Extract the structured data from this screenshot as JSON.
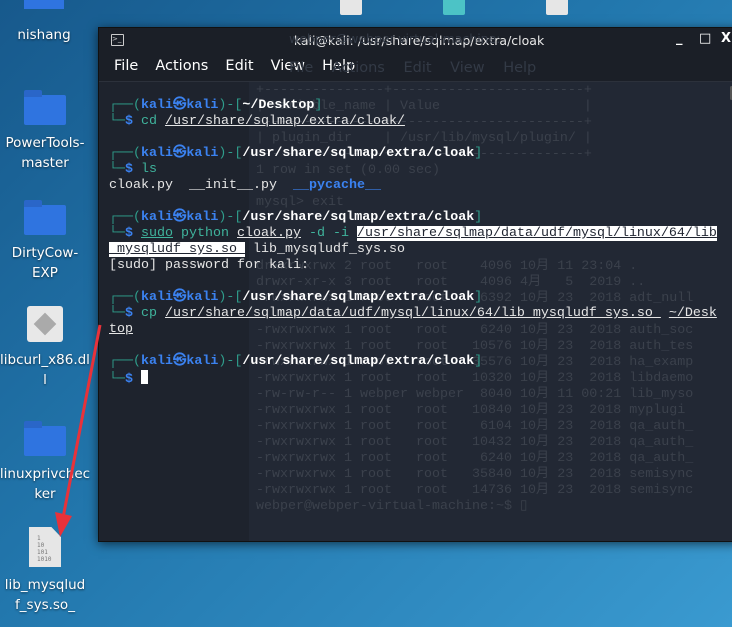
{
  "desktop": {
    "icons": [
      {
        "label": "nishang",
        "type": "folder"
      },
      {
        "label": "PowerTools-master",
        "type": "folder"
      },
      {
        "label": "DirtyCow-EXP",
        "type": "folder"
      },
      {
        "label": "libcurl_x86.dll",
        "type": "dll"
      },
      {
        "label": "linuxprivchecker",
        "type": "folder"
      },
      {
        "label": "lib_mysqludf_sys.so_",
        "type": "binary-file"
      }
    ],
    "binary_glyph": [
      "1",
      "10",
      "101",
      "1010"
    ],
    "colors": {
      "background": "#2277ad",
      "arrow": "#e8323a"
    }
  },
  "window": {
    "title": "kali@kali: /usr/share/sqlmap/extra/cloak",
    "controls": {
      "minimize": "_",
      "maximize": "□",
      "close": "X"
    },
    "menu": [
      "File",
      "Actions",
      "Edit",
      "View",
      "Help"
    ]
  },
  "terminal": {
    "lines": [
      [
        {
          "c": "frame",
          "t": "┌──("
        },
        {
          "c": "user",
          "t": "kali㉿kali"
        },
        {
          "c": "frame",
          "t": ")-["
        },
        {
          "c": "path",
          "t": "~/Desktop"
        },
        {
          "c": "frame",
          "t": "]"
        }
      ],
      [
        {
          "c": "frame",
          "t": "└─"
        },
        {
          "c": "user",
          "t": "$ "
        },
        {
          "c": "cmd",
          "t": "cd "
        },
        {
          "c": "arg ul",
          "t": "/usr/share/sqlmap/extra/cloak/"
        }
      ],
      [],
      [
        {
          "c": "frame",
          "t": "┌──("
        },
        {
          "c": "user",
          "t": "kali㉿kali"
        },
        {
          "c": "frame",
          "t": ")-["
        },
        {
          "c": "path",
          "t": "/usr/share/sqlmap/extra/cloak"
        },
        {
          "c": "frame",
          "t": "]"
        }
      ],
      [
        {
          "c": "frame",
          "t": "└─"
        },
        {
          "c": "user",
          "t": "$ "
        },
        {
          "c": "cmd",
          "t": "ls"
        }
      ],
      [
        {
          "c": "arg",
          "t": "cloak.py  __init__.py  "
        },
        {
          "c": "dir",
          "t": "__pycache__"
        }
      ],
      [],
      [
        {
          "c": "frame",
          "t": "┌──("
        },
        {
          "c": "user",
          "t": "kali㉿kali"
        },
        {
          "c": "frame",
          "t": ")-["
        },
        {
          "c": "path",
          "t": "/usr/share/sqlmap/extra/cloak"
        },
        {
          "c": "frame",
          "t": "]"
        }
      ],
      [
        {
          "c": "frame",
          "t": "└─"
        },
        {
          "c": "user",
          "t": "$ "
        },
        {
          "c": "cmd ul",
          "t": "sudo"
        },
        {
          "c": "cmd",
          "t": " python "
        },
        {
          "c": "arg ul",
          "t": "cloak.py"
        },
        {
          "c": "cmd",
          "t": " -d -i "
        },
        {
          "c": "sel",
          "t": "/usr/share/sqlmap/data/udf/mysql/linux/64/lib"
        }
      ],
      [
        {
          "c": "sel",
          "t": "_mysqludf_sys.so "
        },
        {
          "c": "arg",
          "t": " lib_mysqludf_sys.so"
        }
      ],
      [
        {
          "c": "arg",
          "t": "[sudo] password for kali:"
        }
      ],
      [],
      [
        {
          "c": "frame",
          "t": "┌──("
        },
        {
          "c": "user",
          "t": "kali㉿kali"
        },
        {
          "c": "frame",
          "t": ")-["
        },
        {
          "c": "path",
          "t": "/usr/share/sqlmap/extra/cloak"
        },
        {
          "c": "frame",
          "t": "]"
        }
      ],
      [
        {
          "c": "frame",
          "t": "└─"
        },
        {
          "c": "user",
          "t": "$ "
        },
        {
          "c": "cmd",
          "t": "cp "
        },
        {
          "c": "arg ul",
          "t": "/usr/share/sqlmap/data/udf/mysql/linux/64/lib_mysqludf_sys.so "
        },
        {
          "c": "arg",
          "t": " "
        },
        {
          "c": "arg ul",
          "t": "~/Desk"
        }
      ],
      [
        {
          "c": "arg ul",
          "t": "top"
        }
      ],
      [],
      [
        {
          "c": "frame",
          "t": "┌──("
        },
        {
          "c": "user",
          "t": "kali㉿kali"
        },
        {
          "c": "frame",
          "t": ")-["
        },
        {
          "c": "path",
          "t": "/usr/share/sqlmap/extra/cloak"
        },
        {
          "c": "frame",
          "t": "]"
        }
      ],
      [
        {
          "c": "frame",
          "t": "└─"
        },
        {
          "c": "user",
          "t": "$ "
        },
        {
          "c": "cursor",
          "t": ""
        }
      ]
    ],
    "background_window_text": [
      "+---------------+------------------------+",
      "| Variable_name | Value                  |",
      "+---------------+------------------------+",
      "| plugin_dir    | /usr/lib/mysql/plugin/ |",
      "+---------------+------------------------+",
      "1 row in set (0.00 sec)",
      "",
      "mysql> exit",
      "",
      "",
      "",
      "drwxrwxrwx 2 root   root    4096 10月 11 23:04 .",
      "drwxr-xr-x 3 root   root    4096 4月   5  2019 ..",
      "-rwxrwxrwx 1 root   root    6392 10月 23  2018 adt_null",
      "",
      "-rwxrwxrwx 1 root   root    6240 10月 23  2018 auth_soc",
      "-rwxrwxrwx 1 root   root   10576 10月 23  2018 auth_tes",
      "-rwxrwxrwx 1 root   root   35576 10月 23  2018 ha_examp",
      "-rwxrwxrwx 1 root   root   10320 10月 23  2018 libdaemo",
      "-rw-rw-r-- 1 webper webper  8040 10月 11 00:21 lib_myso",
      "-rwxrwxrwx 1 root   root   10840 10月 23  2018 myplugi",
      "-rwxrwxrwx 1 root   root    6104 10月 23  2018 qa_auth_",
      "-rwxrwxrwx 1 root   root   10432 10月 23  2018 qa_auth_",
      "-rwxrwxrwx 1 root   root    6240 10月 23  2018 qa_auth_",
      "-rwxrwxrwx 1 root   root   35840 10月 23  2018 semisync",
      "-rwxrwxrwx 1 root   root   14736 10月 23  2018 semisync",
      "webper@webper-virtual-machine:~$ ▯"
    ],
    "background_window_title": "webper@webper-virtual-machine:",
    "background_window_menu": [
      "File",
      "Actions",
      "Edit",
      "View",
      "Help"
    ]
  }
}
